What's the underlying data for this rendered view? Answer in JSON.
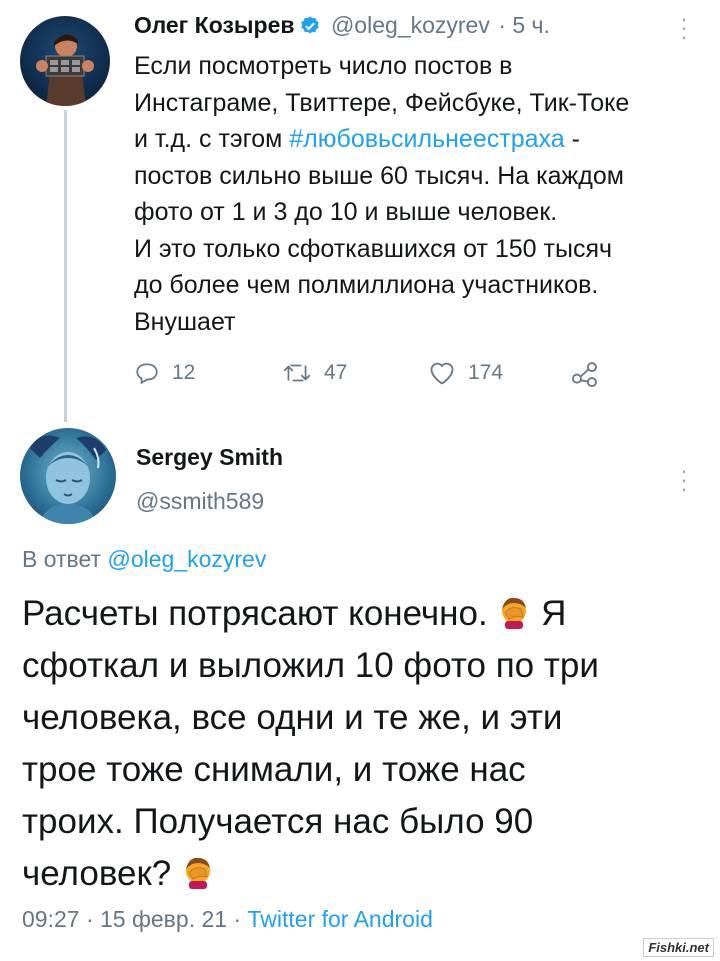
{
  "parent_tweet": {
    "author_name": "Олег Козырев",
    "author_handle": "@oleg_kozyrev",
    "time_ago": "· 5 ч.",
    "text_lines": [
      "Если посмотреть число постов в",
      "Инстаграме, Твиттере, Фейсбуке, Тик-Токе",
      "и т.д. с тэгом ",
      "постов сильно выше 60 тысяч. На каждом",
      "фото от 1 и 3 до 10 и выше человек.",
      "И это только сфоткавшихся от 150 тысяч",
      "до более чем полмиллиона участников.",
      "Внушает"
    ],
    "hashtag": "#любовьсильнеестраха",
    "hashtag_suffix": " -",
    "replies": "12",
    "retweets": "47",
    "likes": "174"
  },
  "reply_tweet": {
    "author_name": "Sergey Smith",
    "author_handle": "@ssmith589",
    "reply_prefix": "В ответ ",
    "reply_to_handle": "@oleg_kozyrev",
    "text_lines": [
      "Расчеты потрясают конечно. ",
      " Я",
      "сфоткал и выложил 10 фото по три",
      "человека, все одни и те же, и эти",
      "трое тоже снимали, и тоже нас",
      "троих. Получается нас было 90",
      "человек? "
    ],
    "timestamp": "09:27 · 15 февр. 21 · ",
    "source": "Twitter for Android"
  },
  "watermark": "Fishki.net",
  "colors": {
    "link": "#1da1f2",
    "secondary": "#657786",
    "text": "#14171a"
  },
  "icons": [
    "verified-badge-icon",
    "reply-icon",
    "retweet-icon",
    "like-icon",
    "share-icon",
    "more-options-icon",
    "facepalm-emoji"
  ]
}
